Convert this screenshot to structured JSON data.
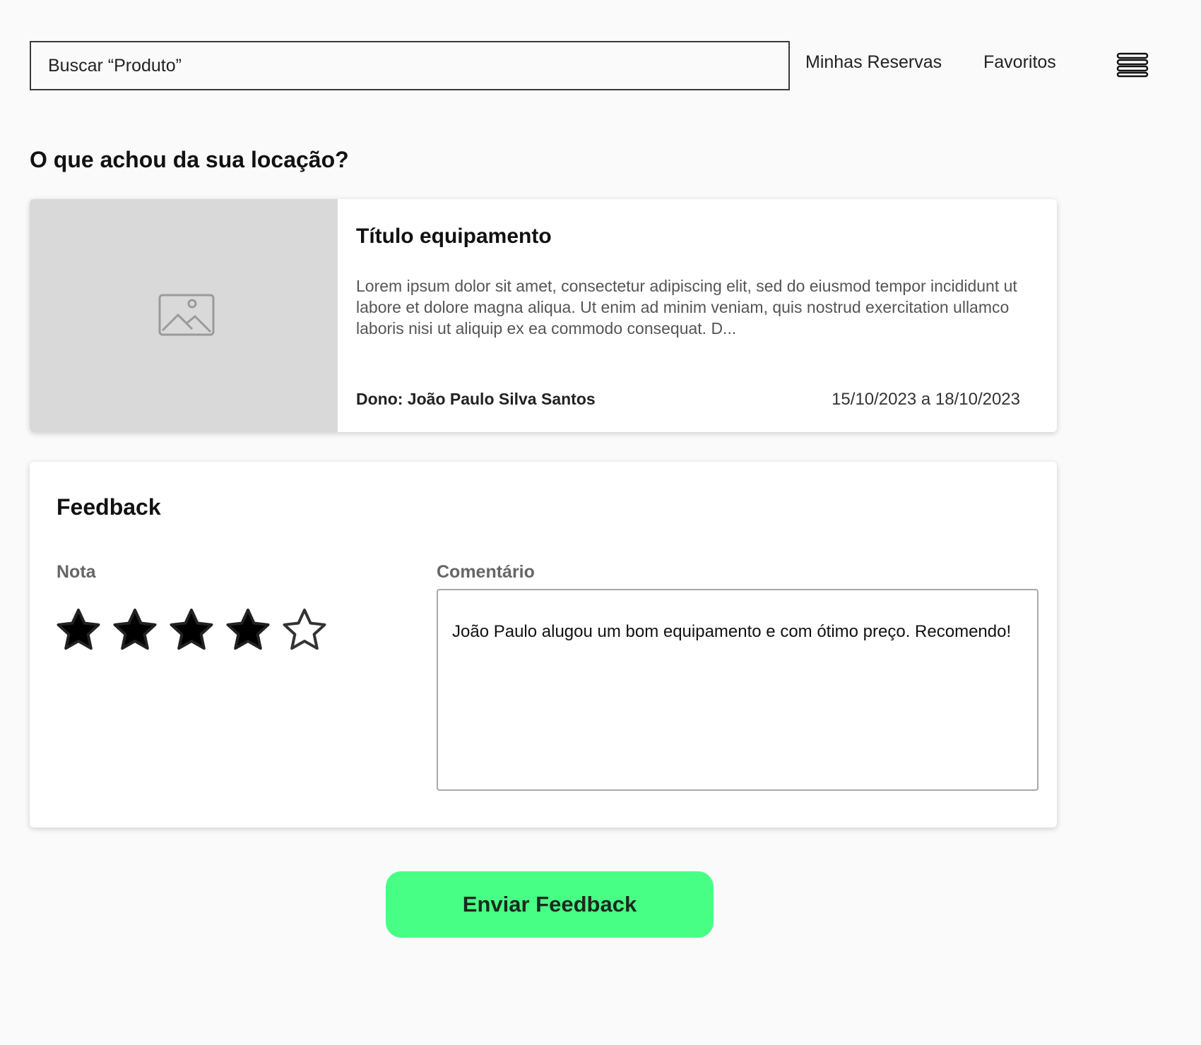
{
  "header": {
    "search_text": "Buscar “Produto”",
    "nav": {
      "reservas": "Minhas Reservas",
      "favoritos": "Favoritos"
    },
    "menu_icon": "hamburger-icon"
  },
  "page": {
    "title": "O que achou da sua locação?"
  },
  "product": {
    "image_icon": "image-placeholder-icon",
    "title": "Título equipamento",
    "description": "Lorem ipsum dolor sit amet, consectetur adipiscing elit, sed do eiusmod tempor incididunt ut labore et dolore magna aliqua. Ut enim ad minim veniam, quis nostrud exercitation ullamco laboris nisi ut aliquip ex ea commodo consequat. D...",
    "owner": "Dono: João Paulo Silva Santos",
    "dates": "15/10/2023 a 18/10/2023"
  },
  "feedback": {
    "title": "Feedback",
    "rating_label": "Nota",
    "rating": 4,
    "rating_max": 5,
    "comment_label": "Comentário",
    "comment": "João Paulo alugou um bom equipamento e com ótimo preço. Recomendo!"
  },
  "actions": {
    "submit_label": "Enviar Feedback",
    "submit_color": "#48ff86"
  }
}
